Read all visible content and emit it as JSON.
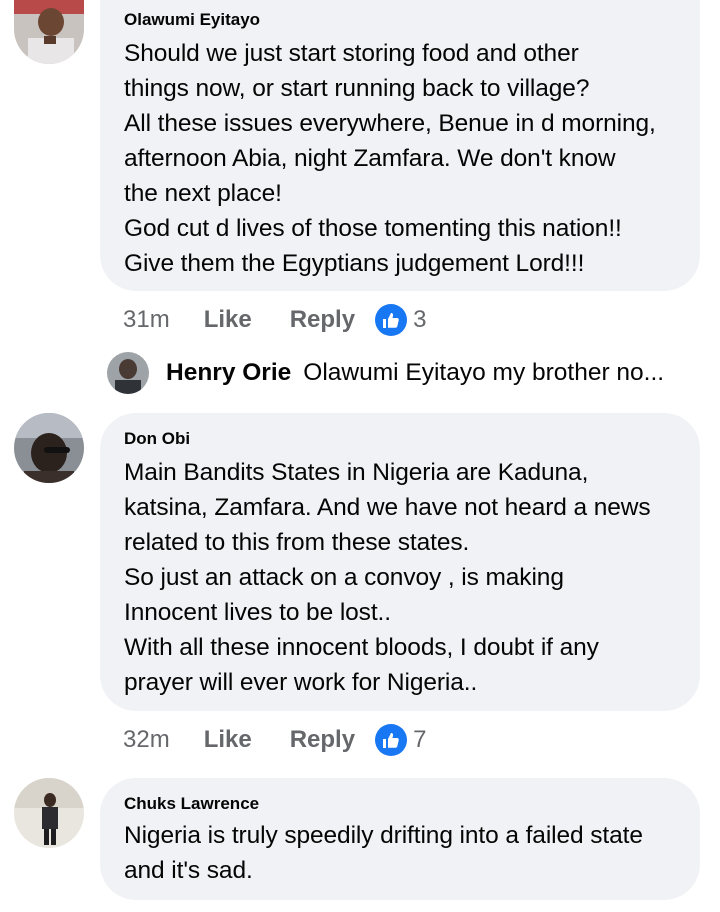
{
  "comments": [
    {
      "author": "Olawumi Eyitayo",
      "text": "Should we just start storing food and other\nthings now, or start running back to village?\nAll these issues everywhere, Benue in d morning,\nafternoon Abia, night Zamfara. We don't know\nthe next place!\nGod cut d lives of those tomenting this nation!!\nGive them the  Egyptians judgement Lord!!!",
      "time": "31m",
      "like_label": "Like",
      "reply_label": "Reply",
      "reaction_icon": "like-thumb-icon",
      "reaction_count": "3"
    },
    {
      "author": "Don Obi",
      "text": "Main Bandits States in Nigeria are Kaduna,\nkatsina, Zamfara. And we have not heard a news\nrelated to this from these states.\nSo just an attack on a convoy , is making\nInnocent lives to be lost..\nWith all these  innocent bloods, I doubt if any\nprayer will ever work for Nigeria..",
      "time": "32m",
      "like_label": "Like",
      "reply_label": "Reply",
      "reaction_icon": "like-thumb-icon",
      "reaction_count": "7"
    },
    {
      "author": "Chuks Lawrence",
      "text": "Nigeria is truly speedily drifting into a failed state\nand it's sad."
    }
  ],
  "reply_preview": {
    "author": "Henry Orie",
    "text": "Olawumi Eyitayo my brother no..."
  },
  "colors": {
    "bubble_bg": "#f0f2f5",
    "meta_text": "#65676b",
    "like_blue": "#1877f2"
  }
}
